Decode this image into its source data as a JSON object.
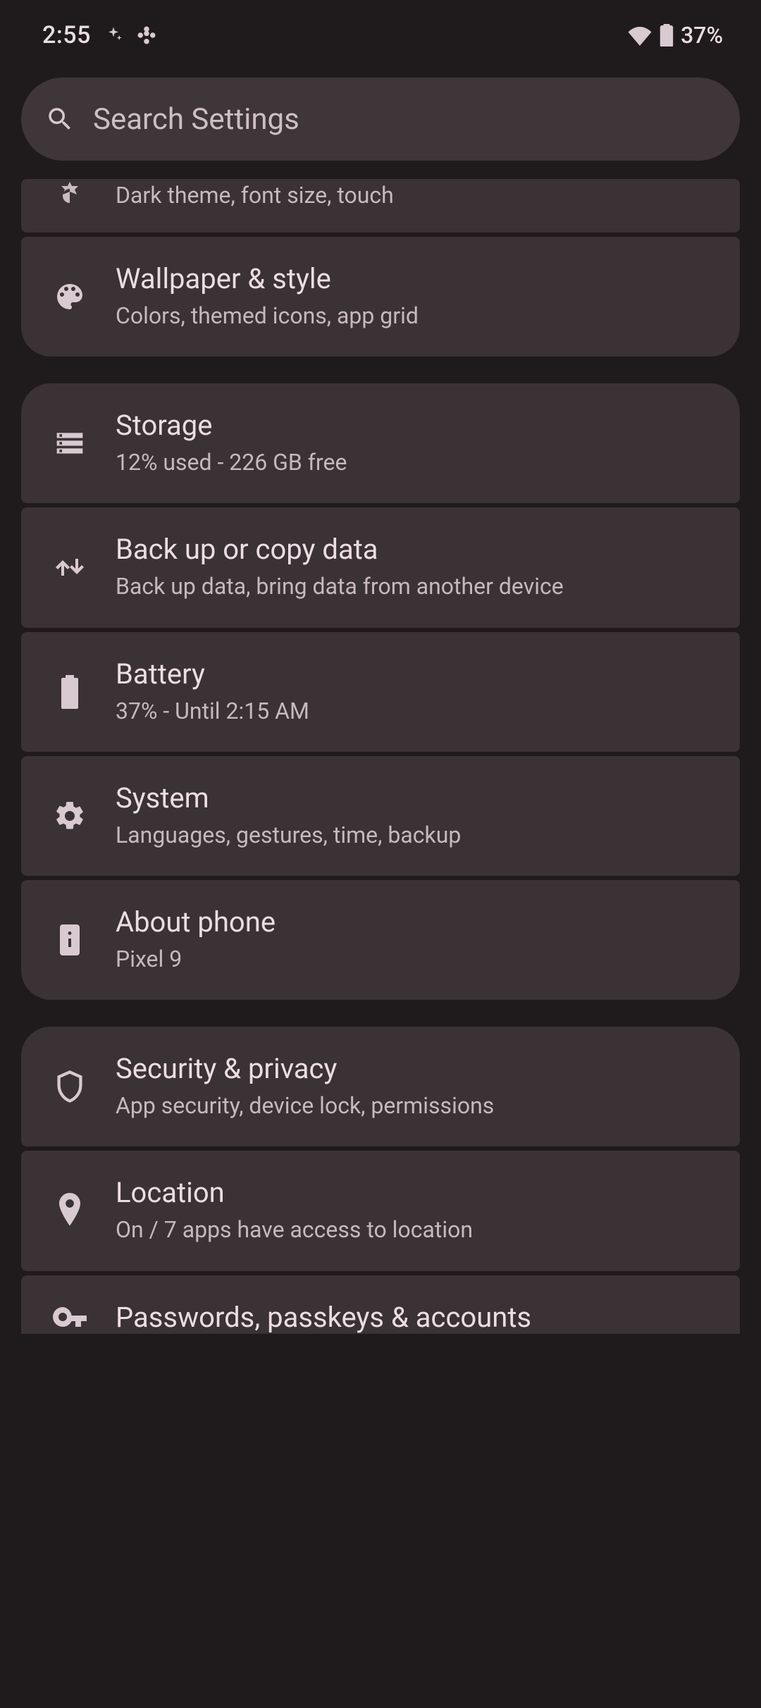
{
  "status": {
    "time": "2:55",
    "battery_pct": "37%"
  },
  "search": {
    "placeholder": "Search Settings"
  },
  "items": {
    "display_sub": "Dark theme, font size, touch",
    "wallpaper_title": "Wallpaper & style",
    "wallpaper_sub": "Colors, themed icons, app grid",
    "storage_title": "Storage",
    "storage_sub": "12% used - 226 GB free",
    "backup_title": "Back up or copy data",
    "backup_sub": "Back up data, bring data from another device",
    "battery_title": "Battery",
    "battery_sub": "37% - Until 2:15 AM",
    "system_title": "System",
    "system_sub": "Languages, gestures, time, backup",
    "about_title": "About phone",
    "about_sub": "Pixel 9",
    "security_title": "Security & privacy",
    "security_sub": "App security, device lock, permissions",
    "location_title": "Location",
    "location_sub": "On / 7 apps have access to location",
    "passwords_title": "Passwords, passkeys & accounts"
  }
}
